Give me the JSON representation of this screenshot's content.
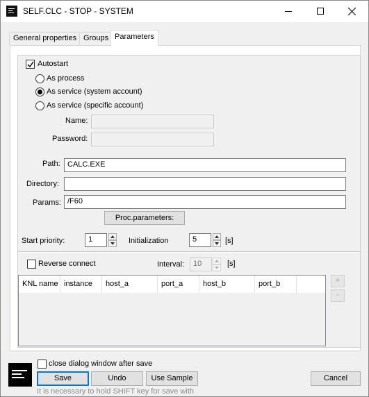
{
  "window": {
    "title": "SELF.CLC - STOP - SYSTEM"
  },
  "tabs": [
    {
      "label": "General properties"
    },
    {
      "label": "Groups"
    },
    {
      "label": "Parameters"
    }
  ],
  "autostart": {
    "label": "Autostart",
    "checked": true
  },
  "run_mode": {
    "options": [
      {
        "label": "As process",
        "selected": false
      },
      {
        "label": "As service (system account)",
        "selected": true
      },
      {
        "label": "As service (specific account)",
        "selected": false
      }
    ]
  },
  "account": {
    "name_label": "Name:",
    "name_value": "",
    "password_label": "Password:",
    "password_value": ""
  },
  "path": {
    "label": "Path:",
    "value": "CALC.EXE"
  },
  "directory": {
    "label": "Directory:",
    "value": ""
  },
  "params": {
    "label": "Params:",
    "value": "/F60"
  },
  "proc_parameters_button": "Proc.parameters:",
  "start_priority": {
    "label": "Start priority:",
    "value": "1"
  },
  "initialization": {
    "label": "Initialization",
    "value": "5",
    "unit": "[s]"
  },
  "reverse_connect": {
    "label": "Reverse connect",
    "checked": false
  },
  "interval": {
    "label": "Interval:",
    "value": "10",
    "unit": "[s]"
  },
  "connections_table": {
    "columns": [
      "KNL name",
      "instance",
      "host_a",
      "port_a",
      "host_b",
      "port_b"
    ],
    "rows": []
  },
  "side_buttons": {
    "add": "+",
    "remove": "-"
  },
  "close_after_save": {
    "label": "close dialog window after save",
    "checked": false
  },
  "footer": {
    "save": "Save",
    "undo": "Undo",
    "use_sample": "Use Sample",
    "cancel": "Cancel",
    "hint": "It is necessary to hold SHIFT key for save with"
  },
  "colors": {
    "accent": "#0078d7",
    "window_bg": "#f0f0f0"
  }
}
